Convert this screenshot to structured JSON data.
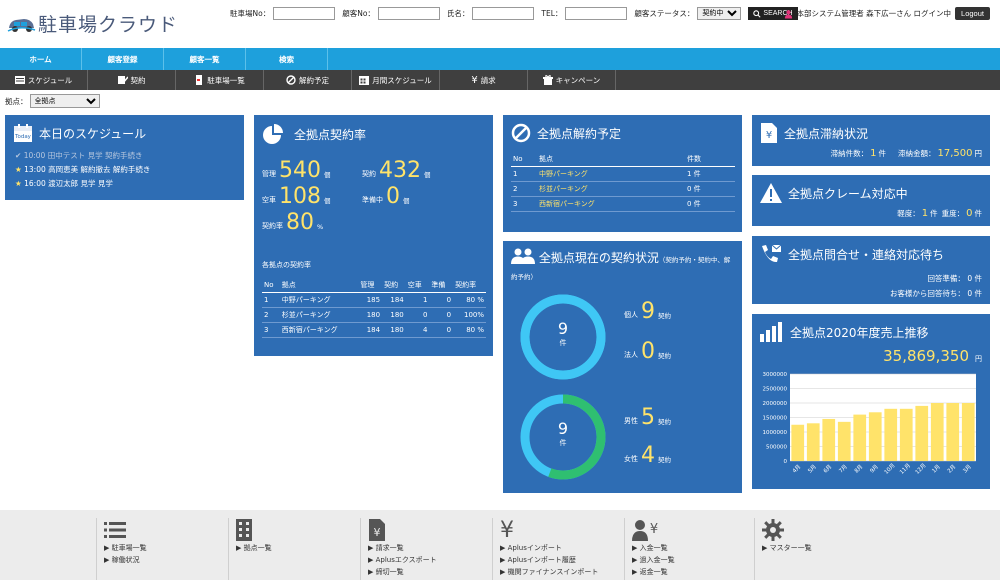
{
  "header": {
    "logo_text": "駐車場クラウド",
    "search": {
      "parking_no_label": "駐車場No：",
      "customer_no_label": "顧客No：",
      "name_label": "氏名：",
      "tel_label": "TEL：",
      "status_label": "顧客ステータス：",
      "status_value": "契約中",
      "search_button": "SEARCH"
    },
    "user_text": "本部システム管理者 森下広一さん ログイン中",
    "logout": "Logout"
  },
  "nav_primary": [
    "ホーム",
    "顧客登録",
    "顧客一覧",
    "検索"
  ],
  "nav_secondary": [
    {
      "label": "スケジュール",
      "icon": "schedule-icon"
    },
    {
      "label": "契約",
      "icon": "contract-icon"
    },
    {
      "label": "駐車場一覧",
      "icon": "parking-list-icon"
    },
    {
      "label": "解約予定",
      "icon": "cancel-icon"
    },
    {
      "label": "月間スケジュール",
      "icon": "calendar-icon"
    },
    {
      "label": "請求",
      "icon": "yen-icon"
    },
    {
      "label": "キャンペーン",
      "icon": "campaign-icon"
    }
  ],
  "location": {
    "label": "拠点：",
    "value": "全拠点"
  },
  "schedule": {
    "title": "本日のスケジュール",
    "items": [
      {
        "time": "10:00",
        "text": "田中テスト 見学 契約手続き",
        "done": true
      },
      {
        "time": "13:00",
        "text": "高岡恵美 解約撤去 解約手続き",
        "done": false
      },
      {
        "time": "16:00",
        "text": "渡辺太郎 見学 見学",
        "done": false
      }
    ]
  },
  "contract_rate": {
    "title": "全拠点契約率",
    "managed_label": "管理",
    "managed": "540",
    "managed_unit": "個",
    "contract_label": "契約",
    "contract": "432",
    "contract_unit": "個",
    "vacant_label": "空車",
    "vacant": "108",
    "vacant_unit": "個",
    "preparing_label": "準備中",
    "preparing": "0",
    "preparing_unit": "個",
    "rate_label": "契約率",
    "rate": "80",
    "rate_unit": "%",
    "table_title": "各拠点の契約率",
    "headers": [
      "No",
      "拠点",
      "管理",
      "契約",
      "空車",
      "準備",
      "契約率"
    ],
    "rows": [
      [
        "1",
        "中野パーキング",
        "185",
        "184",
        "1",
        "0",
        "80 %"
      ],
      [
        "2",
        "杉並パーキング",
        "180",
        "180",
        "0",
        "0",
        "100%"
      ],
      [
        "3",
        "西新宿パーキング",
        "184",
        "180",
        "4",
        "0",
        "80 %"
      ]
    ]
  },
  "cancel_plan": {
    "title": "全拠点解約予定",
    "headers": [
      "No",
      "拠点",
      "件数"
    ],
    "rows": [
      [
        "1",
        "中野パーキング",
        "1 件"
      ],
      [
        "2",
        "杉並パーキング",
        "0 件"
      ],
      [
        "3",
        "西新宿パーキング",
        "0 件"
      ]
    ]
  },
  "current_contracts": {
    "title": "全拠点現在の契約状況",
    "subtitle": "（契約予約・契約中、解約予約）",
    "total1": "9",
    "total1_unit": "件",
    "individual_label": "個人",
    "individual": "9",
    "individual_unit": "契約",
    "corporate_label": "法人",
    "corporate": "0",
    "corporate_unit": "契約",
    "total2": "9",
    "total2_unit": "件",
    "male_label": "男性",
    "male": "5",
    "male_unit": "契約",
    "female_label": "女性",
    "female": "4",
    "female_unit": "契約",
    "ring1_fraction": 1.0,
    "ring2_fraction": 0.5556,
    "ring_color": "#3fc7f5",
    "ring2_color": "#2fbf71"
  },
  "arrears": {
    "title": "全拠点滞納状況",
    "count_label": "滞納件数：",
    "count": "1",
    "count_unit": "件",
    "amount_label": "滞納金額：",
    "amount": "17,500",
    "amount_unit": "円"
  },
  "claims": {
    "title": "全拠点クレーム対応中",
    "light_label": "軽度：",
    "light": "1",
    "light_unit": "件",
    "heavy_label": "重度：",
    "heavy": "0",
    "heavy_unit": "件"
  },
  "inquiry": {
    "title": "全拠点問合せ・連絡対応待ち",
    "pending_label": "回答準備：",
    "pending": "0",
    "pending_unit": "件",
    "waiting_label": "お客様から回答待ち：",
    "waiting": "0",
    "waiting_unit": "件"
  },
  "sales": {
    "title": "全拠点2020年度売上推移",
    "total": "35,869,350",
    "total_unit": "円"
  },
  "chart_data": {
    "type": "bar",
    "categories": [
      "4月",
      "5月",
      "6月",
      "7月",
      "8月",
      "9月",
      "10月",
      "11月",
      "12月",
      "1月",
      "2月",
      "3月"
    ],
    "values": [
      1250000,
      1300000,
      1450000,
      1350000,
      1600000,
      1680000,
      1800000,
      1800000,
      1900000,
      2000000,
      2000000,
      2000000
    ],
    "ylim": [
      0,
      3000000
    ],
    "yticks": [
      "0",
      "500000",
      "1000000",
      "1500000",
      "2000000",
      "2500000",
      "3000000"
    ],
    "bar_color": "#ffe36a"
  },
  "footer": [
    {
      "icon": "list-icon",
      "links": [
        "駐車場一覧",
        "稼働状況"
      ]
    },
    {
      "icon": "building-icon",
      "links": [
        "拠点一覧"
      ]
    },
    {
      "icon": "invoice-icon",
      "links": [
        "請求一覧",
        "Aplusエクスポート",
        "締切一覧"
      ]
    },
    {
      "icon": "yen-icon",
      "links": [
        "Aplusインポート",
        "Aplusインポート履歴",
        "機関ファイナンスインポート"
      ]
    },
    {
      "icon": "payment-icon",
      "links": [
        "入金一覧",
        "過入金一覧",
        "返金一覧"
      ]
    },
    {
      "icon": "gear-icon",
      "links": [
        "マスター一覧"
      ]
    }
  ]
}
